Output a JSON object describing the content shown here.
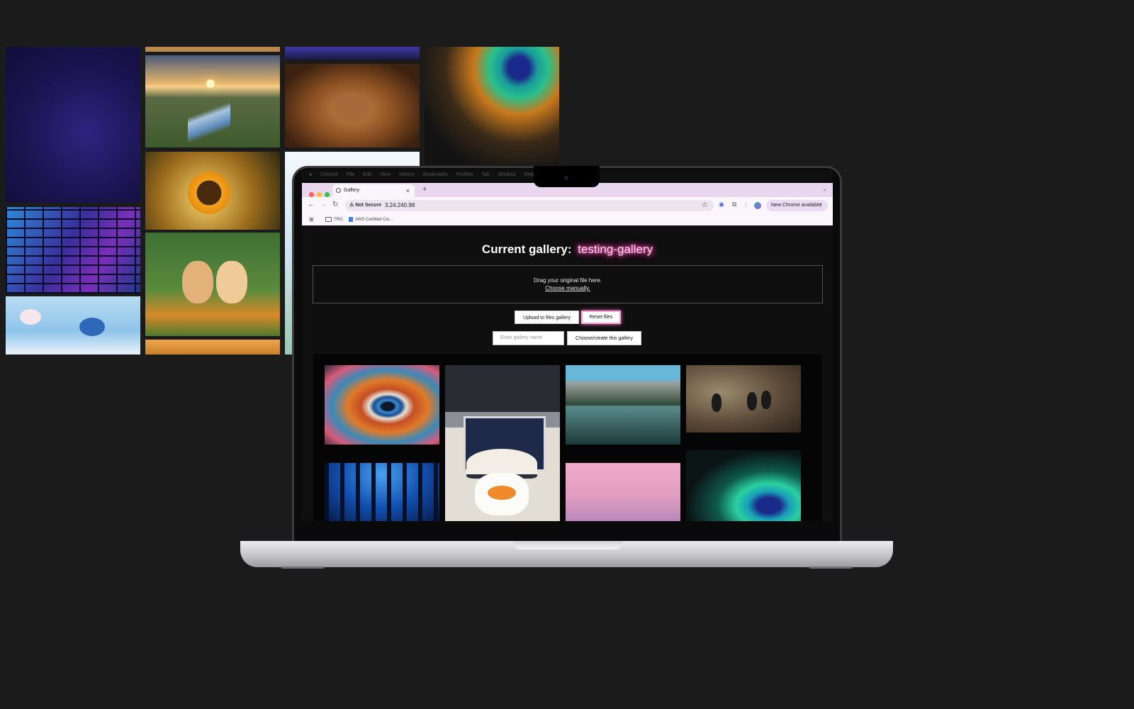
{
  "background": {
    "color": "#1b1b1b",
    "tiles": [
      {
        "name": "purple-abstract-wallpaper",
        "colors": [
          "#2a1f6e",
          "#191244"
        ]
      },
      {
        "name": "river-sunset-landscape",
        "colors": [
          "#d8a45f",
          "#3d5a2c"
        ]
      },
      {
        "name": "mountain-dusk-landscape",
        "colors": [
          "#3c3aa0",
          "#1d1a4c"
        ]
      },
      {
        "name": "orangutan-photo",
        "colors": [
          "#b0703a",
          "#4e2a14"
        ]
      },
      {
        "name": "peacock-feather-photo",
        "colors": [
          "#1a8a7a",
          "#e0702a"
        ]
      },
      {
        "name": "sunflower-photo",
        "colors": [
          "#f2a21c",
          "#3a2e10"
        ]
      },
      {
        "name": "neon-brick-wall",
        "colors": [
          "#2aa4e8",
          "#5a2aa8"
        ]
      },
      {
        "name": "golden-retriever-puppies",
        "colors": [
          "#d9a25c",
          "#4d7a30"
        ]
      },
      {
        "name": "bluebird-blossom-photo",
        "colors": [
          "#bfe0f5",
          "#3a7bc7"
        ]
      },
      {
        "name": "sky-light-photo",
        "colors": [
          "#e8f3f8",
          "#9cc7b2"
        ]
      }
    ]
  },
  "mac": {
    "menu_items": [
      "Chrome",
      "File",
      "Edit",
      "View",
      "History",
      "Bookmarks",
      "Profiles",
      "Tab",
      "Window",
      "Help"
    ]
  },
  "browser": {
    "tab_title": "Gallery",
    "tab_close": "×",
    "new_tab": "+",
    "tab_list_icon": "⌄",
    "security_label": "Not Secure",
    "url": "3.24.240.98",
    "new_chrome_label": "New Chrome available",
    "bookmarks": [
      "TRG",
      "AWS Certified Clo..."
    ]
  },
  "page": {
    "heading_label": "Current gallery:",
    "gallery_name": "testing-gallery",
    "dropzone_text": "Drag your original file here.",
    "dropzone_link": "Choose manually.",
    "upload_button": "Upload to files gallery",
    "reset_button": "Reset files",
    "gallery_input_placeholder": "Enter gallery name",
    "choose_button": "Choose/create this gallery"
  },
  "gallery_images": [
    {
      "name": "colorful-eye-photo",
      "colors": [
        "#e0662e",
        "#2a5ea8"
      ]
    },
    {
      "name": "duck-plush-laptop-photo",
      "colors": [
        "#eae6de",
        "#33363e"
      ]
    },
    {
      "name": "mountain-lake-photo",
      "colors": [
        "#7ab8d8",
        "#2f4a3a"
      ]
    },
    {
      "name": "puffins-photo",
      "colors": [
        "#7a6a55",
        "#3a3025"
      ]
    },
    {
      "name": "blue-forest-butterflies",
      "colors": [
        "#1b5ec0",
        "#081a40"
      ]
    },
    {
      "name": "pink-sky-photo",
      "colors": [
        "#e9a3c0",
        "#b884b8"
      ]
    },
    {
      "name": "peacock-feather-photo",
      "colors": [
        "#0e6c6a",
        "#1a2a60"
      ]
    }
  ]
}
